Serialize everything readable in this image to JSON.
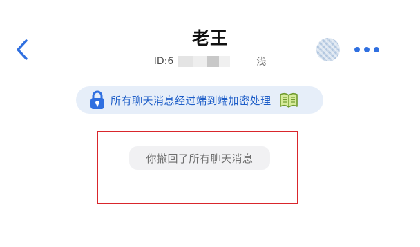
{
  "header": {
    "title": "老王",
    "id_prefix": "ID:6",
    "id_suffix": "浅"
  },
  "encryption_banner": {
    "text": "所有聊天消息经过端到端加密处理",
    "lock_icon": "lock-icon",
    "book_icon": "book-icon"
  },
  "messages": {
    "system_notice": "你撤回了所有聊天消息"
  },
  "colors": {
    "accent": "#2f6fe0",
    "banner_background": "#e6eef9",
    "banner_text": "#1e5ec8",
    "highlight": "#d9262c",
    "notice_background": "#f1f1f3",
    "notice_text": "#6f6f6f"
  }
}
